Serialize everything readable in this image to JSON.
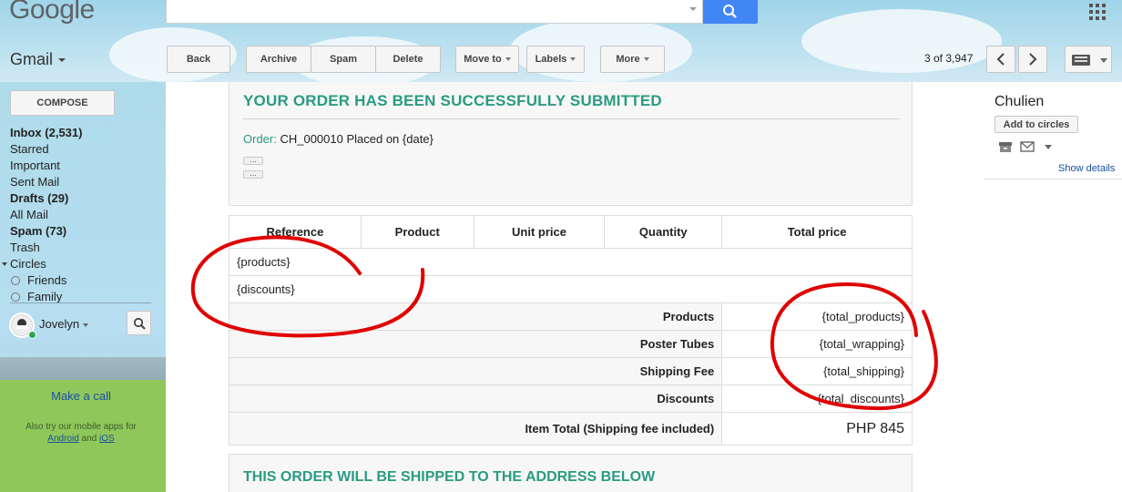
{
  "header": {
    "logo_text": "Google",
    "app_label": "Gmail",
    "toolbar": {
      "back": "Back",
      "archive": "Archive",
      "spam": "Spam",
      "delete": "Delete",
      "move_to": "Move to",
      "labels": "Labels",
      "more": "More"
    },
    "page_count": "3 of 3,947",
    "icons": [
      "search-icon",
      "apps-grid-icon",
      "chevron-left-icon",
      "chevron-right-icon",
      "keyboard-icon"
    ]
  },
  "sidebar": {
    "compose": "COMPOSE",
    "items": [
      {
        "label": "Inbox (2,531)"
      },
      {
        "label": "Starred"
      },
      {
        "label": "Important"
      },
      {
        "label": "Sent Mail"
      },
      {
        "label": "Drafts (29)"
      },
      {
        "label": "All Mail"
      },
      {
        "label": "Spam (73)"
      },
      {
        "label": "Trash"
      },
      {
        "label": "Circles"
      },
      {
        "label": "Friends"
      },
      {
        "label": "Family"
      }
    ],
    "user_name": "Jovelyn",
    "make_call": "Make a call",
    "mobile_prefix": "Also try our mobile apps for",
    "android": "Android",
    "and": "and",
    "ios": "iOS"
  },
  "email": {
    "title": "YOUR ORDER HAS BEEN SUCCESSFULLY SUBMITTED",
    "order_label": "Order:",
    "order_value": "CH_000010 Placed on {date}",
    "collapsed_marker": "...",
    "table": {
      "headers": [
        "Reference",
        "Product",
        "Unit price",
        "Quantity",
        "Total price"
      ],
      "products_placeholder": "{products}",
      "discounts_placeholder": "{discounts}",
      "summary": [
        {
          "label": "Products",
          "value": "{total_products}"
        },
        {
          "label": "Poster Tubes",
          "value": "{total_wrapping}"
        },
        {
          "label": "Shipping Fee",
          "value": "{total_shipping}"
        },
        {
          "label": "Discounts",
          "value": "{total_discounts}"
        },
        {
          "label": "Item Total (Shipping fee included)",
          "value": "PHP 845"
        }
      ]
    },
    "shipping_title": "THIS ORDER WILL BE SHIPPED TO THE ADDRESS BELOW"
  },
  "contact": {
    "name": "Chulien",
    "add_to_circles": "Add to circles",
    "show_details": "Show details"
  },
  "colors": {
    "accent_green": "#2a9b80",
    "search_blue": "#4285f4",
    "annotation_red": "#e00000"
  }
}
